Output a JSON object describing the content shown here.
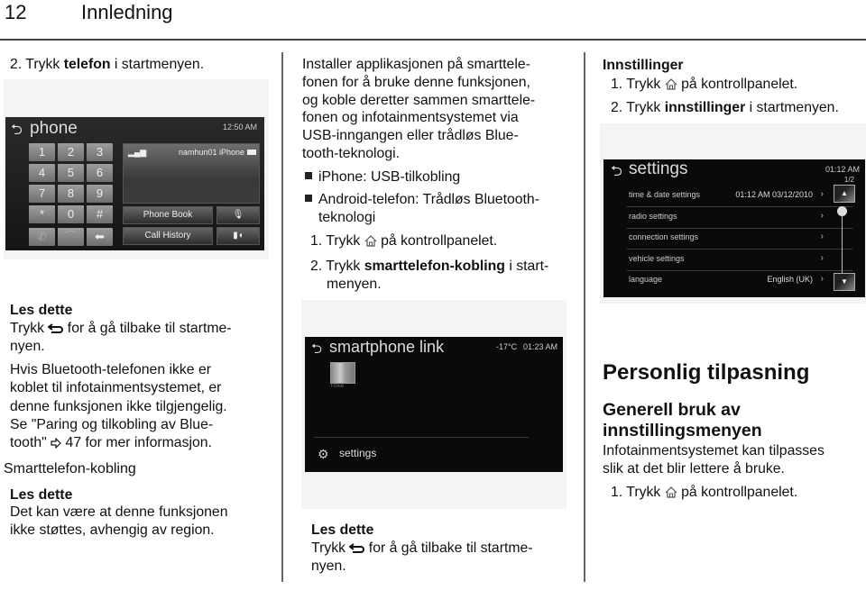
{
  "header": {
    "page_number": "12",
    "chapter_title": "Innledning"
  },
  "col1": {
    "step2": {
      "num": "2.",
      "pre": "Trykk ",
      "bold": "telefon",
      "post": " i startmenyen."
    },
    "phone_screen": {
      "title": "phone",
      "time": "12:50 AM",
      "keys": [
        "1",
        "2",
        "3",
        "4",
        "5",
        "6",
        "7",
        "8",
        "9",
        "*",
        "0",
        "#"
      ],
      "device_name": "namhun01  iPhone",
      "phone_book_label": "Phone Book",
      "call_history_label": "Call History"
    },
    "note1": {
      "heading": "Les dette",
      "line1_pre": "Trykk ",
      "line1_post": " for å gå tilbake til startme-",
      "line2": "nyen."
    },
    "para": [
      "Hvis Bluetooth-telefonen ikke er",
      "koblet til infotainmentsystemet, er",
      "denne funksjonen ikke tilgjengelig.",
      "Se \"Paring og tilkobling av Blue-"
    ],
    "para_last_pre": "tooth\" ",
    "para_last_post": " 47 for mer informasjon.",
    "section_heading": "Smarttelefon-kobling",
    "note2": {
      "heading": "Les dette",
      "lines": [
        "Det kan være at denne funksjonen",
        "ikke støttes, avhengig av region."
      ]
    }
  },
  "col2": {
    "intro": [
      "Installer applikasjonen på smarttele-",
      "fonen for å bruke denne funksjonen,",
      "og koble deretter sammen smarttele-",
      "fonen og infotainmentsystemet via",
      "USB-inngangen eller trådløs Blue-",
      "tooth-teknologi."
    ],
    "bullets": [
      {
        "lines": [
          "iPhone: USB-tilkobling"
        ]
      },
      {
        "lines": [
          "Android-telefon: Trådløs Bluetooth-",
          "teknologi"
        ]
      }
    ],
    "step1": {
      "num": "1.",
      "pre": "Trykk ",
      "post": " på kontrollpanelet."
    },
    "step2": {
      "num": "2.",
      "pre": "Trykk ",
      "bold": "smarttelefon-kobling",
      "post": " i start-",
      "line2": "menyen."
    },
    "smartphone_screen": {
      "title": "smartphone link",
      "temperature": "-17°C",
      "time": "01:23 AM",
      "app_label": "Trove",
      "settings_label": "settings"
    },
    "note": {
      "heading": "Les dette",
      "line1_pre": "Trykk ",
      "line1_post": " for å gå tilbake til startme-",
      "line2": "nyen."
    }
  },
  "col3": {
    "heading": "Innstillinger",
    "step1": {
      "num": "1.",
      "pre": "Trykk ",
      "post": " på kontrollpanelet."
    },
    "step2": {
      "num": "2.",
      "pre": "Trykk ",
      "bold": "innstillinger",
      "post": " i startmenyen."
    },
    "settings_screen": {
      "title": "settings",
      "time": "01:12 AM",
      "page_indicator": "1/2",
      "rows": [
        {
          "label": "time & date settings",
          "value": "01:12 AM   03/12/2010"
        },
        {
          "label": "radio settings",
          "value": ""
        },
        {
          "label": "connection settings",
          "value": ""
        },
        {
          "label": "vehicle settings",
          "value": ""
        },
        {
          "label": "language",
          "value": "English (UK)"
        }
      ],
      "chevron": "›"
    },
    "section_title": "Personlig tilpasning",
    "subheading_lines": [
      "Generell bruk av",
      "innstillingsmenyen"
    ],
    "body": [
      "Infotainmentsystemet kan tilpasses",
      "slik at det blir lettere å bruke."
    ],
    "step1b": {
      "num": "1.",
      "pre": "Trykk ",
      "post": " på kontrollpanelet."
    }
  }
}
